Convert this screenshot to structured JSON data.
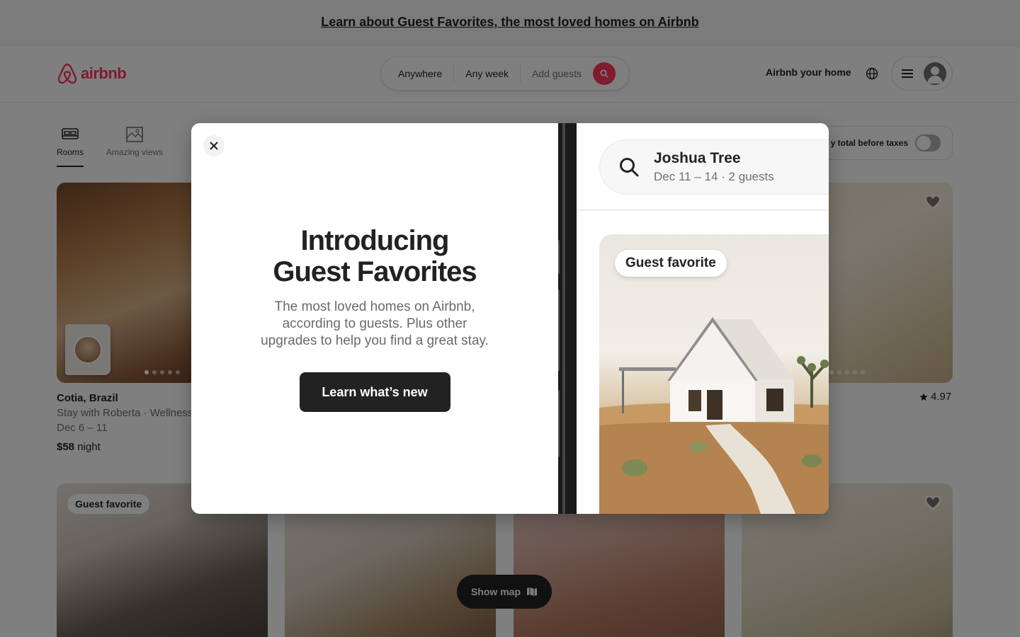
{
  "banner": {
    "link_text": "Learn about Guest Favorites, the most loved homes on Airbnb"
  },
  "header": {
    "logo_text": "airbnb",
    "search": {
      "where": "Anywhere",
      "when": "Any week",
      "who": "Add guests"
    },
    "host_link": "Airbnb your home"
  },
  "categories": [
    {
      "label": "Rooms",
      "icon": "bed-icon",
      "active": true
    },
    {
      "label": "Amazing views",
      "icon": "landscape-icon",
      "active": false
    }
  ],
  "tax_toggle": {
    "label": "y total before taxes"
  },
  "listings": [
    {
      "location": "Cotia, Brazil",
      "subtitle": "Stay with Roberta · Wellness",
      "dates": "Dec 6 – 11",
      "price": "$58",
      "price_unit": "night"
    },
    {
      "rating": "4.97"
    }
  ],
  "guest_badge": "Guest favorite",
  "show_map": "Show map",
  "modal": {
    "title_line1": "Introducing",
    "title_line2": "Guest Favorites",
    "description": "The most loved homes on Airbnb, according to guests. Plus other upgrades to help you find a great stay.",
    "cta": "Learn what’s new",
    "phone": {
      "search_where": "Joshua Tree",
      "search_when": "Dec 11 – 14 · 2 guests",
      "badge": "Guest favorite"
    }
  },
  "colors": {
    "brand": "#ff385c",
    "text": "#222222",
    "muted": "#717171"
  }
}
